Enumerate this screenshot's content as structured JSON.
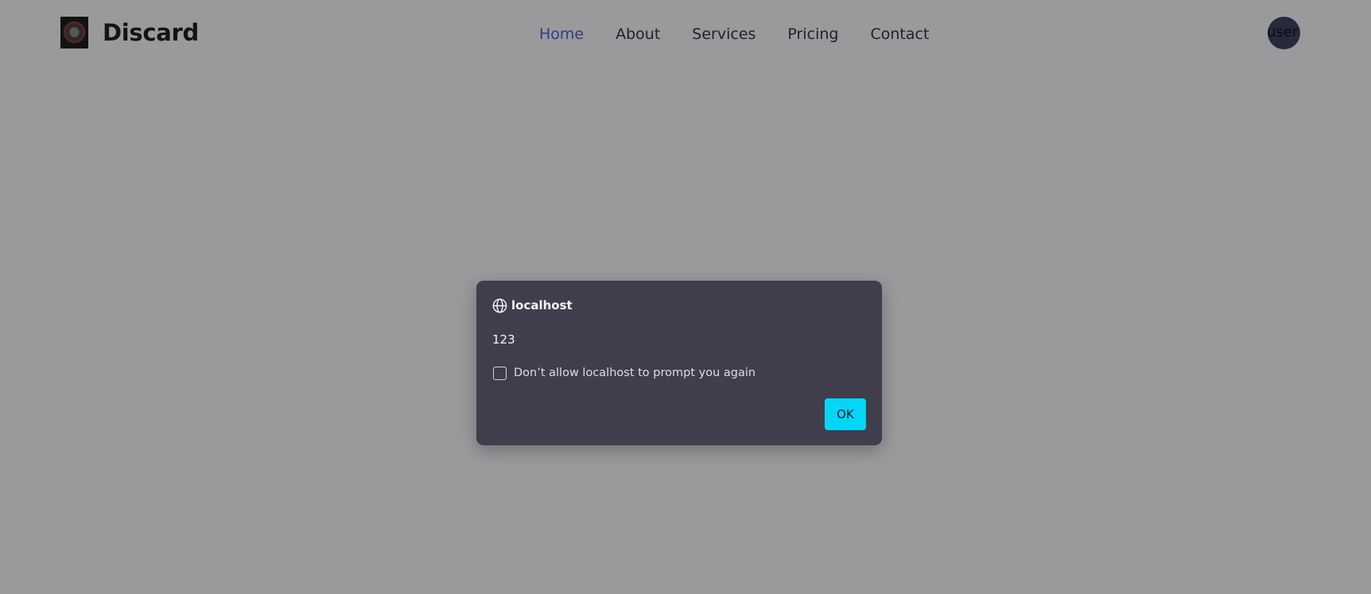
{
  "brand": {
    "name": "Discard",
    "logo_icon": "anime-emblem-logo"
  },
  "nav": {
    "items": [
      {
        "label": "Home",
        "active": true
      },
      {
        "label": "About",
        "active": false
      },
      {
        "label": "Services",
        "active": false
      },
      {
        "label": "Pricing",
        "active": false
      },
      {
        "label": "Contact",
        "active": false
      }
    ]
  },
  "user": {
    "avatar_label": "user"
  },
  "dialog": {
    "origin": "localhost",
    "origin_icon": "globe-icon",
    "message": "123",
    "checkbox_label": "Don’t allow localhost to prompt you again",
    "checkbox_checked": false,
    "ok_label": "OK"
  },
  "colors": {
    "overlay_background": "#9a9a9c",
    "nav_active": "#2e3d86",
    "dialog_background": "#403e4c",
    "ok_button": "#05d6f5"
  }
}
